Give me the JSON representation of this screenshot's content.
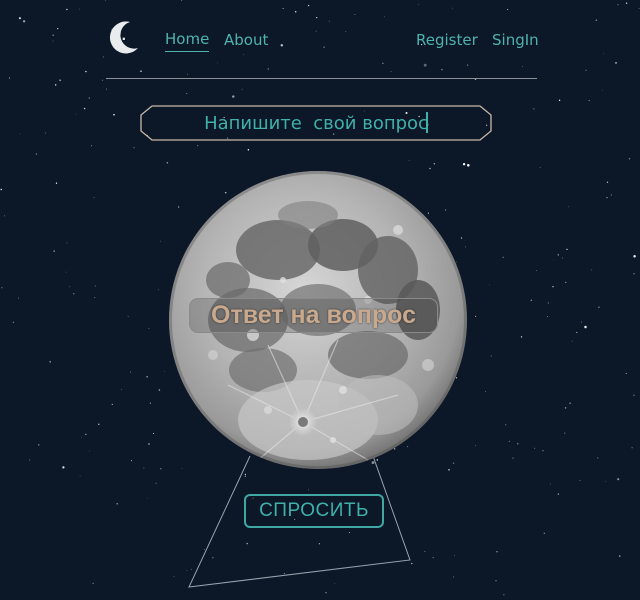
{
  "nav": {
    "logo_glyph": ".?.",
    "links": [
      "Home",
      "About",
      "Register",
      "SingIn"
    ],
    "active": "Home"
  },
  "question": {
    "placeholder": "Напишите  свой вопрос"
  },
  "answer": {
    "text": "Ответ на вопрос"
  },
  "ask_button": {
    "label": "СПРОСИТЬ"
  },
  "colors": {
    "background": "#0c1728",
    "accent": "#3fb0aa",
    "answer_text": "#c9a98d",
    "divider": "#8a8f98"
  },
  "icons": {
    "logo": "crescent-moon-question-icon"
  }
}
